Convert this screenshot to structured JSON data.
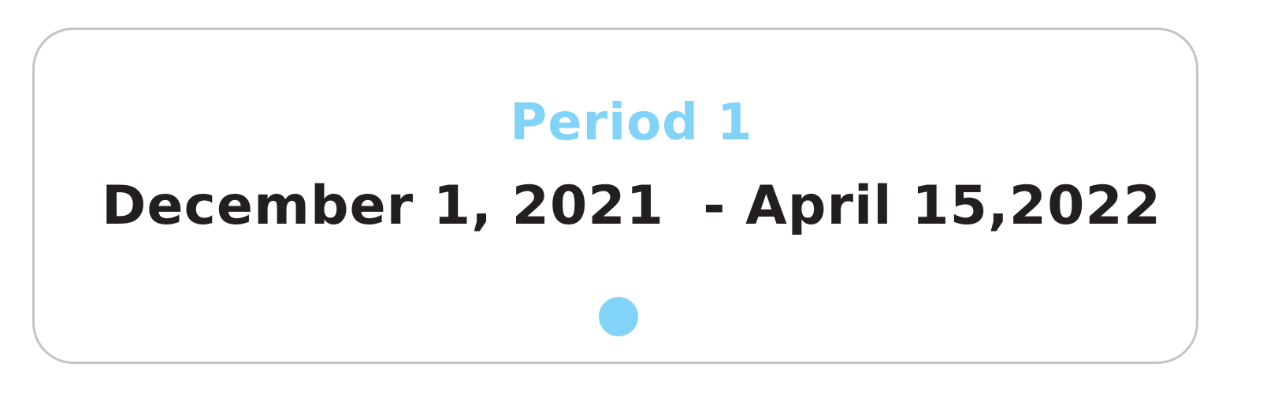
{
  "card": {
    "title": "Period 1",
    "date_range": "December 1, 2021  - April 15,2022"
  },
  "colors": {
    "accent": "#81d3f7",
    "text": "#231f20",
    "border": "#c4c4c4",
    "background": "#ffffff"
  }
}
